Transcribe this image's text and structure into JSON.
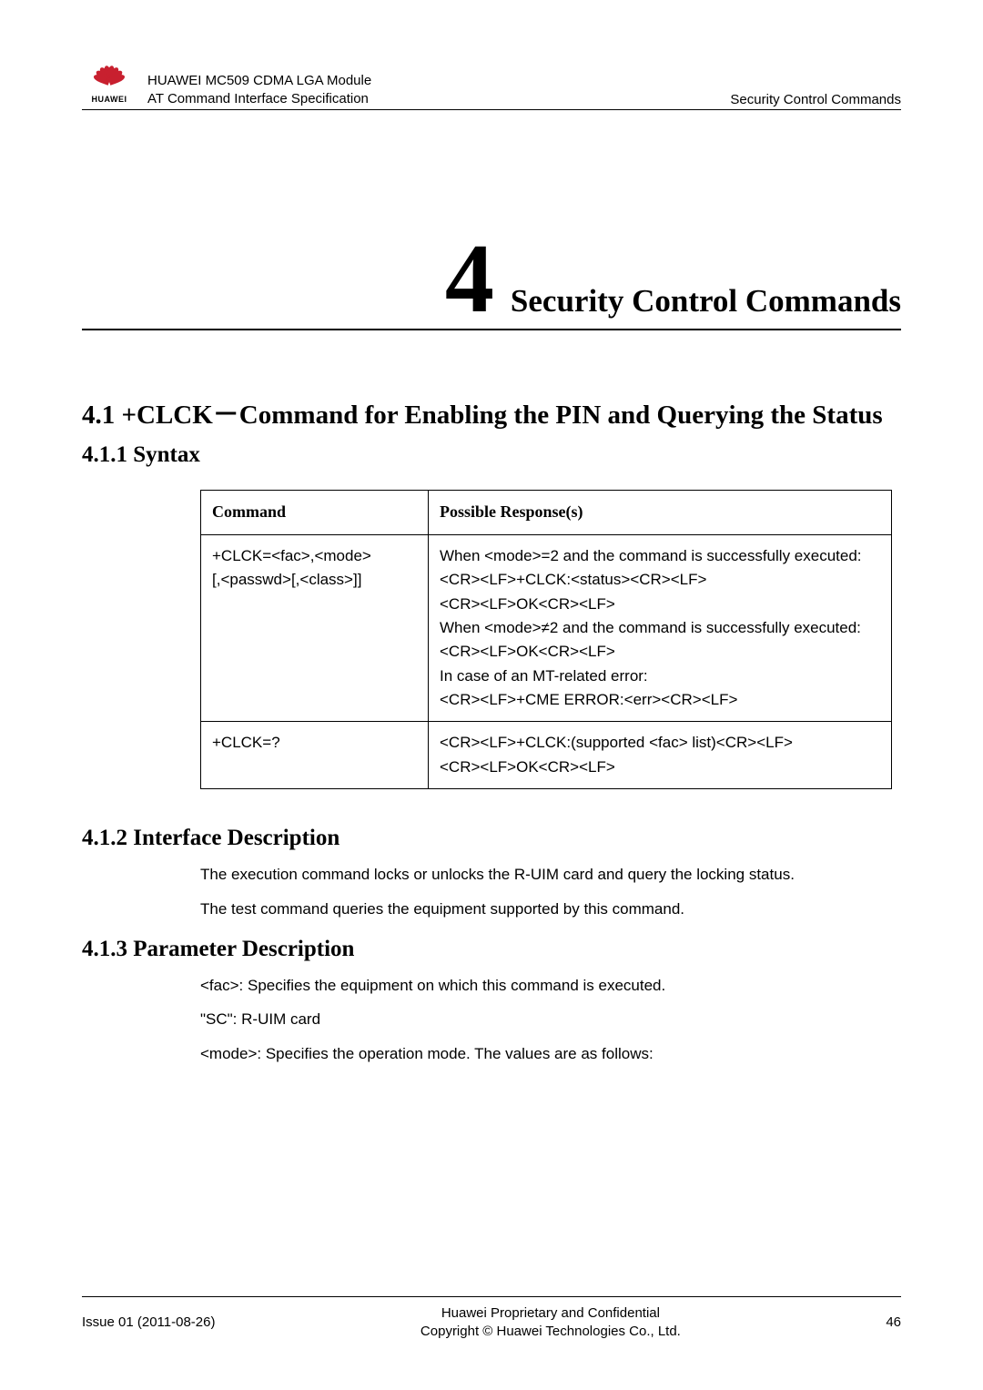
{
  "header": {
    "doc_title_line1": "HUAWEI MC509 CDMA LGA Module",
    "doc_title_line2": "AT Command Interface Specification",
    "section_name": "Security Control Commands",
    "logo_label": "HUAWEI"
  },
  "chapter": {
    "number": "4",
    "title": "Security Control Commands"
  },
  "section_4_1": {
    "heading": "4.1 +CLCK－Command for Enabling the PIN and Querying the Status"
  },
  "section_4_1_1": {
    "heading": "4.1.1 Syntax",
    "table": {
      "header_command": "Command",
      "header_response": "Possible Response(s)",
      "rows": [
        {
          "command": "+CLCK=<fac>,<mode>\n[,<passwd>[,<class>]]",
          "response": [
            "When <mode>=2 and the command is successfully executed:",
            "<CR><LF>+CLCK:<status><CR><LF>",
            "<CR><LF>OK<CR><LF>",
            "When <mode>≠2 and the command is successfully executed:",
            "<CR><LF>OK<CR><LF>",
            "In case of an MT-related error:",
            "<CR><LF>+CME ERROR:<err><CR><LF>"
          ]
        },
        {
          "command": "+CLCK=?",
          "response": [
            "<CR><LF>+CLCK:(supported <fac> list)<CR><LF>",
            "<CR><LF>OK<CR><LF>"
          ]
        }
      ]
    }
  },
  "section_4_1_2": {
    "heading": "4.1.2 Interface Description",
    "para1": "The execution command locks or unlocks the R-UIM card and query the locking status.",
    "para2": "The test command queries the equipment supported by this command."
  },
  "section_4_1_3": {
    "heading": "4.1.3 Parameter Description",
    "para1": "<fac>: Specifies the equipment on which this command is executed.",
    "para2": "\"SC\": R-UIM card",
    "para3": "<mode>: Specifies the operation mode. The values are as follows:"
  },
  "footer": {
    "issue": "Issue 01 (2011-08-26)",
    "line1": "Huawei Proprietary and Confidential",
    "line2": "Copyright © Huawei Technologies Co., Ltd.",
    "page": "46"
  }
}
